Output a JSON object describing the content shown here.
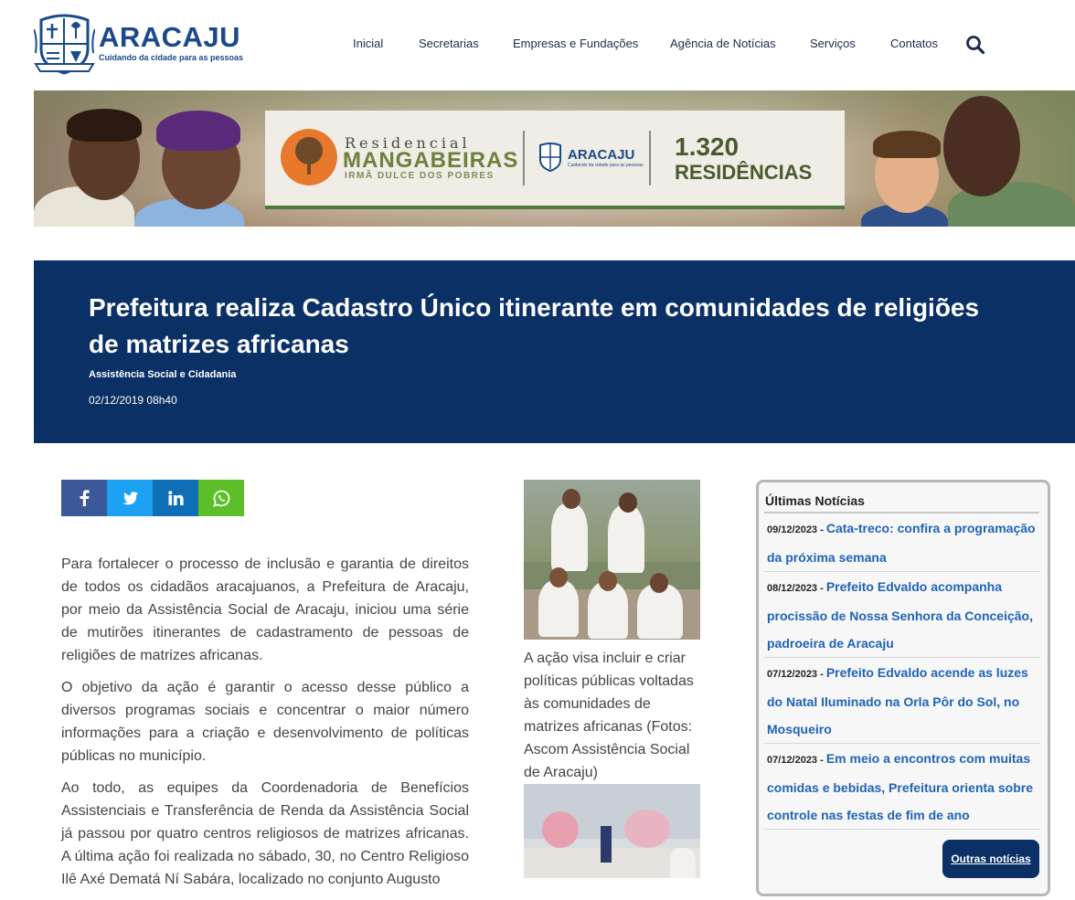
{
  "header": {
    "brand": "ARACAJU",
    "tagline": "Cuidando da cidade para as pessoas",
    "nav": [
      "Inicial",
      "Secretarias",
      "Empresas e Fundações",
      "Agência de Notícias",
      "Serviços",
      "Contatos"
    ],
    "search_icon": "search-icon"
  },
  "banner": {
    "line1": "Residencial",
    "line2": "MANGABEIRAS",
    "line3": "IRMÃ DULCE DOS POBRES",
    "logo_text": "ARACAJU",
    "logo_tagline": "Cuidando da cidade para as pessoas",
    "number": "1.320",
    "label": "RESIDÊNCIAS"
  },
  "article": {
    "title": "Prefeitura realiza Cadastro Único itinerante em comunidades de religiões de matrizes africanas",
    "category": "Assistência Social e Cidadania",
    "date": "02/12/2019 08h40",
    "paragraphs": [
      "Para fortalecer o processo de inclusão e garantia de direitos de todos os cidadãos aracajuanos, a Prefeitura de Aracaju, por meio da Assistência Social de Aracaju, iniciou uma série de mutirões itinerantes de cadastramento de pessoas de religiões de matrizes africanas.",
      "O objetivo da ação é garantir o acesso desse público a diversos programas sociais e concentrar o maior número informações para a criação e desenvolvimento de políticas públicas no município.",
      "Ao todo, as equipes da Coordenadoria de Benefícios Assistenciais e Transferência de Renda da Assistência Social já passou por quatro centros religiosos de matrizes africanas. A última ação foi realizada no sábado, 30, no Centro Religioso Ilê Axé Dematá Ní Sabára, localizado no conjunto Augusto"
    ],
    "caption": "A ação visa incluir e criar políticas públicas voltadas às comunidades de matrizes africanas (Fotos: Ascom Assistência Social de Aracaju)"
  },
  "share": [
    "facebook-icon",
    "twitter-icon",
    "linkedin-icon",
    "whatsapp-icon"
  ],
  "sidebar": {
    "title": "Últimas Notícias",
    "items": [
      {
        "date": "09/12/2023 - ",
        "title": "Cata-treco: confira a programação da próxima semana"
      },
      {
        "date": "08/12/2023 - ",
        "title": "Prefeito Edvaldo acompanha procissão de Nossa Senhora da Conceição, padroeira de Aracaju"
      },
      {
        "date": "07/12/2023 - ",
        "title": "Prefeito Edvaldo acende as luzes do Natal Iluminado na Orla Pôr do Sol, no Mosqueiro"
      },
      {
        "date": "07/12/2023 - ",
        "title": "Em meio a encontros com muitas comidas e bebidas, Prefeitura orienta sobre controle nas festas de fim de ano"
      }
    ],
    "more": "Outras notícias"
  },
  "colors": {
    "navy": "#0a3066",
    "link_blue": "#1f63b8",
    "facebook": "#3b5998",
    "twitter": "#1da1f2",
    "linkedin": "#0077b5",
    "whatsapp": "#25d366"
  }
}
